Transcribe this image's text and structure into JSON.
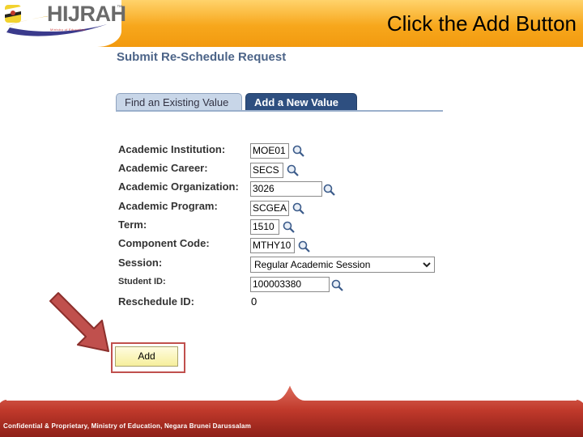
{
  "header": {
    "logo_text": "HIJRAH",
    "logo_tm": "™",
    "logo_tagline": "Ministry of Education",
    "instruction": "Click the Add Button"
  },
  "form": {
    "title": "Submit Re-Schedule Request",
    "tabs": [
      {
        "label": "Find an Existing Value",
        "active": false
      },
      {
        "label": "Add a New Value",
        "active": true
      }
    ],
    "fields": {
      "academic_institution": {
        "label": "Academic Institution:",
        "value": "MOE01"
      },
      "academic_career": {
        "label": "Academic Career:",
        "value": "SECS"
      },
      "academic_organization": {
        "label": "Academic Organization:",
        "value": "3026"
      },
      "academic_program": {
        "label": "Academic Program:",
        "value": "SCGEA"
      },
      "term": {
        "label": "Term:",
        "value": "1510"
      },
      "component_code": {
        "label": "Component Code:",
        "value": "MTHY10"
      },
      "session": {
        "label": "Session:",
        "value": "Regular Academic Session"
      },
      "student_id": {
        "label": "Student  ID:",
        "value": "100003380"
      },
      "reschedule_id": {
        "label": "Reschedule ID:",
        "value": "0"
      }
    },
    "add_button": "Add"
  },
  "footer": {
    "text": "Confidential & Proprietary, Ministry of Education, Negara Brunei Darussalam"
  },
  "colors": {
    "banner": "#f7a71c",
    "footer": "#c0392b",
    "title": "#4c6488",
    "tab_active": "#2e4f80",
    "arrow": "#c0504d"
  }
}
